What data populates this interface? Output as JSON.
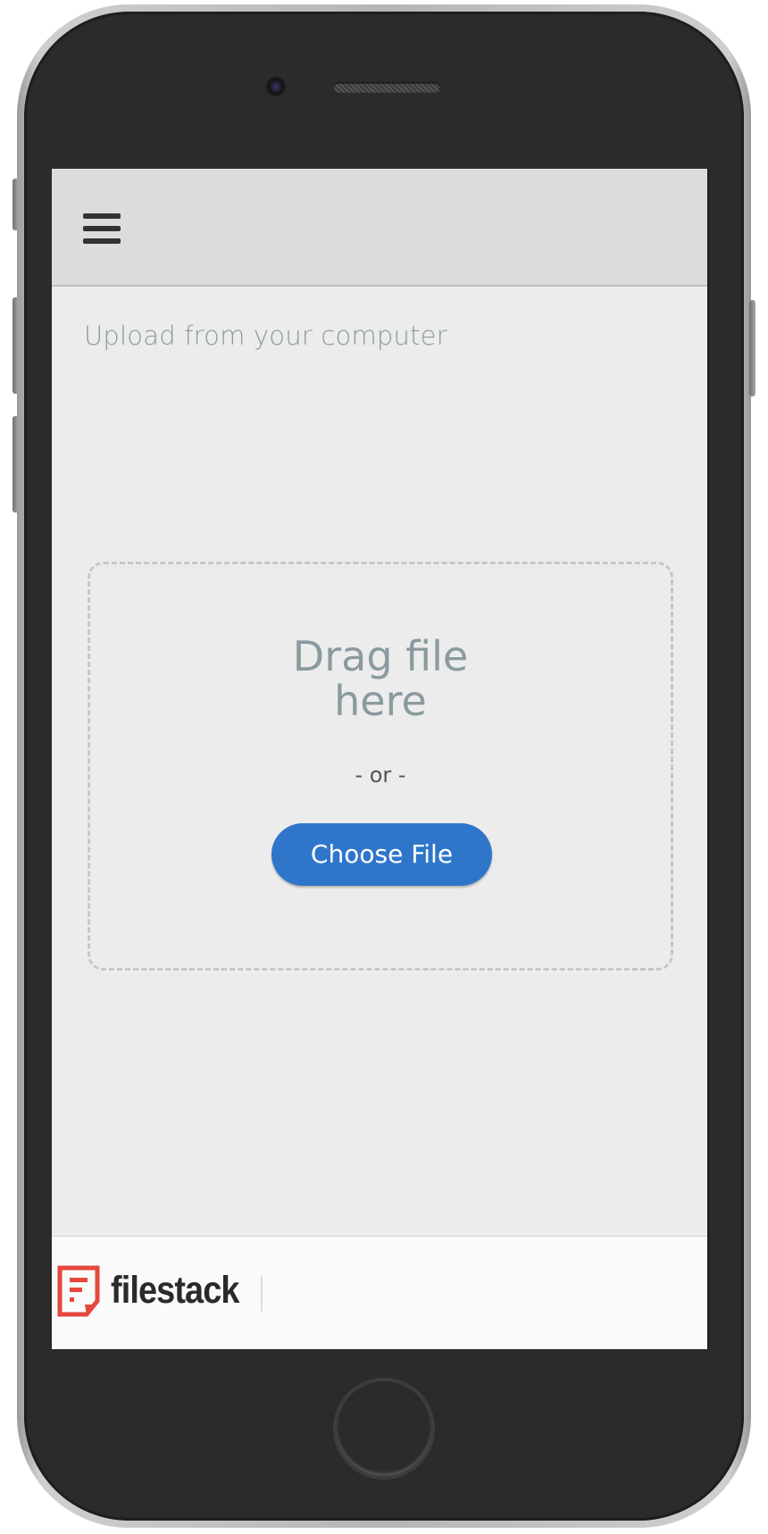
{
  "header": {
    "menu_icon": "hamburger-menu-icon"
  },
  "main": {
    "section_title": "Upload from your computer",
    "dropzone": {
      "drag_line1": "Drag file",
      "drag_line2": "here",
      "or_text": "- or -",
      "choose_button_label": "Choose File"
    }
  },
  "footer": {
    "logo_icon": "filestack-logo-icon",
    "logo_text": "filestack"
  },
  "colors": {
    "accent": "#2f76cb",
    "logo_red": "#e5473d",
    "muted_text": "#8a9a9e"
  }
}
